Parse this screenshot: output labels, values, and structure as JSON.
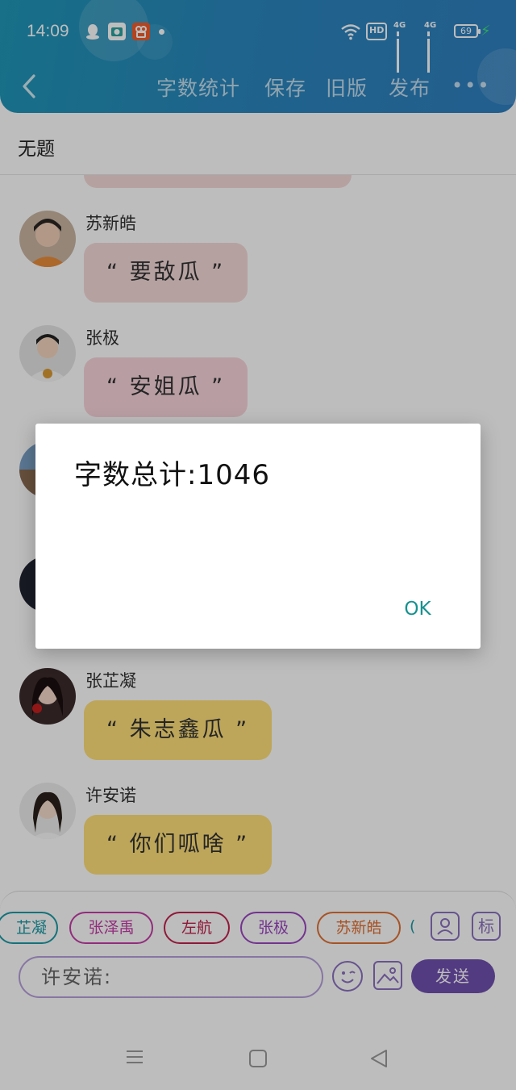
{
  "status_bar": {
    "time": "14:09",
    "hd_label": "HD",
    "net_1": "4G",
    "net_2": "4G",
    "battery": "69"
  },
  "header": {
    "menu": [
      "字数统计",
      "保存",
      "旧版",
      "发布"
    ],
    "more": "•••"
  },
  "doc_title": "无题",
  "messages": [
    {
      "sender": "苏新皓",
      "text": "“ 要敌瓜 ”",
      "bubble_color": "#f6dada"
    },
    {
      "sender": "张极",
      "text": "“ 安姐瓜 ”",
      "bubble_color": "#f8d6dc"
    },
    {
      "sender": "张芷凝",
      "text": "“ 朱志鑫瓜 ”",
      "bubble_color": "#ffe07a"
    },
    {
      "sender": "许安诺",
      "text": "“ 你们呱啥 ”",
      "bubble_color": "#ffe07a"
    }
  ],
  "character_tags": [
    {
      "label": "芷凝",
      "color": "#1b9aa5"
    },
    {
      "label": "张泽禹",
      "color": "#c53ca8"
    },
    {
      "label": "左航",
      "color": "#c2234e"
    },
    {
      "label": "张极",
      "color": "#9b45c2"
    },
    {
      "label": "苏新皓",
      "color": "#e07034"
    },
    {
      "label": "(",
      "color": "#1b9aa5"
    }
  ],
  "composer": {
    "input_value": "许安诺:",
    "mark_button": "标",
    "send_label": "发送"
  },
  "dialog": {
    "message": "字数总计:1046",
    "ok_label": "OK"
  },
  "colors": {
    "header_gradient_start": "#1f97b7",
    "header_gradient_end": "#2f7fc0",
    "accent_purple": "#7050b0",
    "dialog_ok": "#16928f"
  }
}
